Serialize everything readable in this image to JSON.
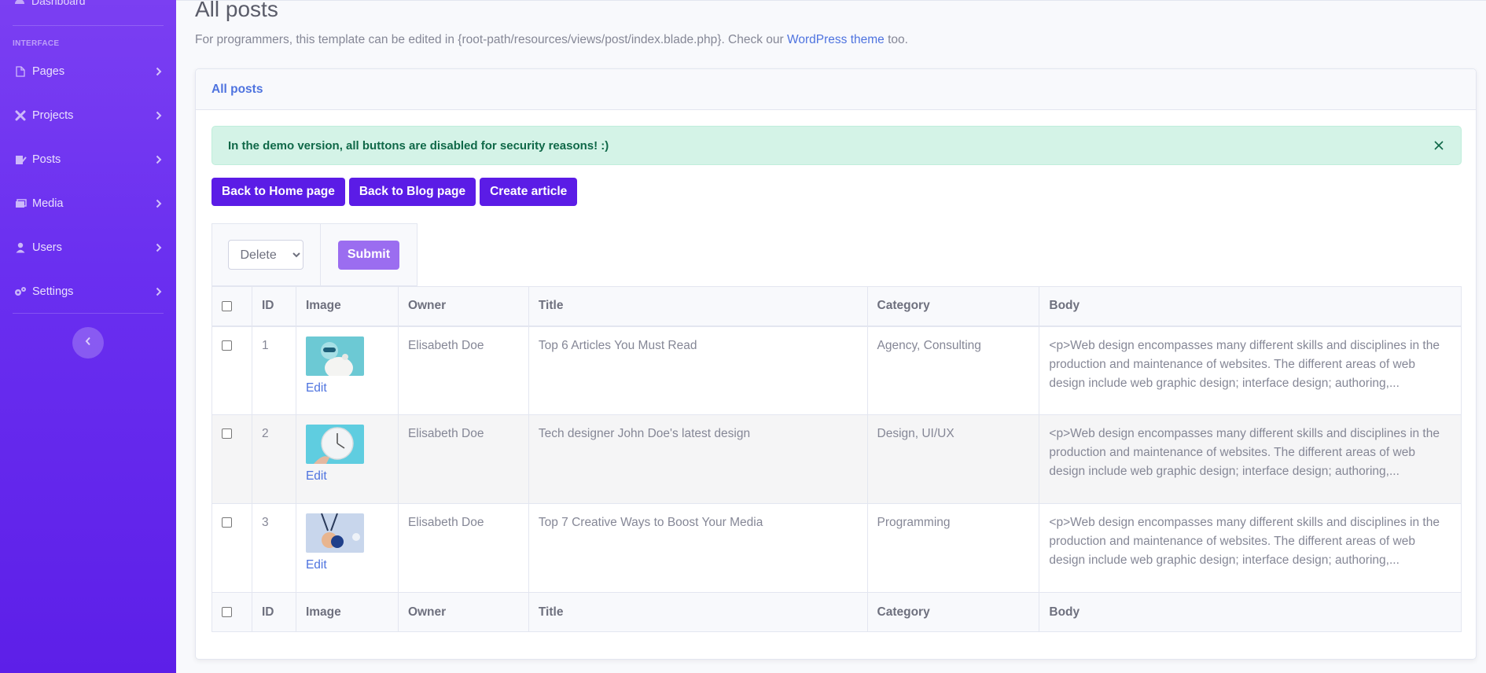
{
  "sidebar": {
    "dashboard_label": "Dashboard",
    "heading": "INTERFACE",
    "items": [
      {
        "label": "Pages",
        "icon": "file-icon"
      },
      {
        "label": "Projects",
        "icon": "tools-icon"
      },
      {
        "label": "Posts",
        "icon": "file-signature-icon"
      },
      {
        "label": "Media",
        "icon": "images-icon"
      },
      {
        "label": "Users",
        "icon": "user-icon"
      },
      {
        "label": "Settings",
        "icon": "cogs-icon"
      }
    ],
    "toggle_icon": "chevron-left-icon"
  },
  "page": {
    "title": "All posts",
    "desc_before": "For programmers, this template can be edited in {root-path/resources/views/post/index.blade.php}. Check our ",
    "desc_link": "WordPress theme",
    "desc_after": " too."
  },
  "card": {
    "header": "All posts",
    "alert": "In the demo version, all buttons are disabled for security reasons! :)",
    "buttons": [
      "Back to Home page",
      "Back to Blog page",
      "Create article"
    ],
    "bulk_action": {
      "selected": "Delete",
      "submit_label": "Submit"
    }
  },
  "table": {
    "columns": [
      "ID",
      "Image",
      "Owner",
      "Title",
      "Category",
      "Body"
    ],
    "edit_label": "Edit",
    "rows": [
      {
        "id": "1",
        "owner": "Elisabeth Doe",
        "title": "Top 6 Articles You Must Read",
        "category": "Agency, Consulting",
        "body": "<p>Web design encompasses many different skills and disciplines in the production and maintenance of websites. The different areas of web design include web graphic design; interface design; authoring,..."
      },
      {
        "id": "2",
        "owner": "Elisabeth Doe",
        "title": "Tech designer John Doe's latest design",
        "category": "Design, UI/UX",
        "body": "<p>Web design encompasses many different skills and disciplines in the production and maintenance of websites. The different areas of web design include web graphic design; interface design; authoring,..."
      },
      {
        "id": "3",
        "owner": "Elisabeth Doe",
        "title": "Top 7 Creative Ways to Boost Your Media",
        "category": "Programming",
        "body": "<p>Web design encompasses many different skills and disciplines in the production and maintenance of websites. The different areas of web design include web graphic design; interface design; authoring,..."
      }
    ]
  },
  "colors": {
    "sidebar": "#6a2ff0",
    "primary_button": "#5b1ce6",
    "link": "#4e73df",
    "alert_bg": "#d4f3e7"
  }
}
